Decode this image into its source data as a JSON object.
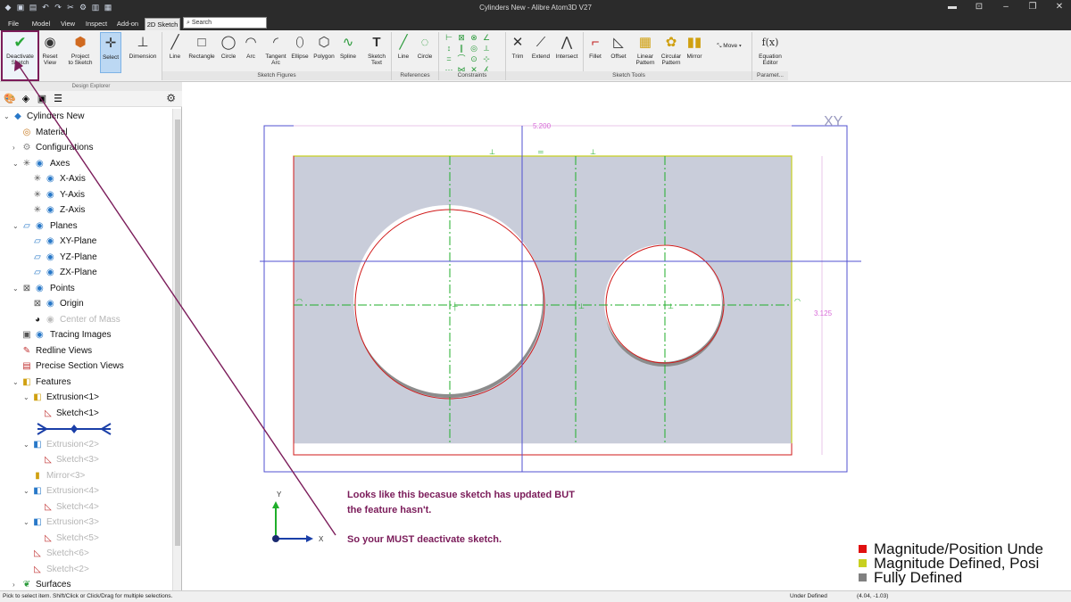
{
  "app": {
    "title": "Cylinders New - Alibre Atom3D V27"
  },
  "quick_access_icons": [
    "app-logo-icon",
    "save-icon",
    "open-icon",
    "undo-icon",
    "redo-icon",
    "cut-icon",
    "settings-icon",
    "folder-icon",
    "save-as-icon"
  ],
  "menu_tabs": [
    "File",
    "Model",
    "View",
    "Inspect",
    "Add-on",
    "2D Sketch"
  ],
  "active_tab": "2D Sketch",
  "search": {
    "placeholder": "Search"
  },
  "ribbon": {
    "buttons": [
      {
        "label_1": "Deactivate",
        "label_2": "Sketch"
      },
      {
        "label_1": "Reset",
        "label_2": "View"
      },
      {
        "label_1": "Project",
        "label_2": "to Sketch"
      },
      {
        "label_1": "Select",
        "label_2": ""
      },
      {
        "label_1": "Dimension",
        "label_2": ""
      },
      {
        "label_1": "Line",
        "label_2": ""
      },
      {
        "label_1": "Rectangle",
        "label_2": ""
      },
      {
        "label_1": "Circle",
        "label_2": ""
      },
      {
        "label_1": "Arc",
        "label_2": ""
      },
      {
        "label_1": "Tangent",
        "label_2": "Arc"
      },
      {
        "label_1": "Ellipse",
        "label_2": ""
      },
      {
        "label_1": "Polygon",
        "label_2": ""
      },
      {
        "label_1": "Spline",
        "label_2": ""
      },
      {
        "label_1": "Sketch",
        "label_2": "Text"
      },
      {
        "label_1": "Line",
        "label_2": ""
      },
      {
        "label_1": "Circle",
        "label_2": ""
      },
      {
        "label_1": "Trim",
        "label_2": ""
      },
      {
        "label_1": "Extend",
        "label_2": ""
      },
      {
        "label_1": "Intersect",
        "label_2": ""
      },
      {
        "label_1": "Fillet",
        "label_2": ""
      },
      {
        "label_1": "Offset",
        "label_2": ""
      },
      {
        "label_1": "Linear",
        "label_2": "Pattern"
      },
      {
        "label_1": "Circular",
        "label_2": "Pattern"
      },
      {
        "label_1": "Mirror",
        "label_2": ""
      },
      {
        "label_1": "Move",
        "label_2": ""
      },
      {
        "label_1": "Equation",
        "label_2": "Editor"
      }
    ],
    "groups": [
      "Sketch Figures",
      "References",
      "Constraints",
      "Sketch Tools",
      "Paramet..."
    ]
  },
  "explorer": {
    "header": "Design Explorer",
    "tree": [
      {
        "label": "Cylinders New",
        "icon": "part-icon"
      },
      {
        "label": "Material",
        "icon": "material-icon"
      },
      {
        "label": "Configurations",
        "icon": "configurations-icon"
      },
      {
        "label": "Axes",
        "icon": "axes-icon"
      },
      {
        "label": "X-Axis",
        "icon": "axis-icon"
      },
      {
        "label": "Y-Axis",
        "icon": "axis-icon"
      },
      {
        "label": "Z-Axis",
        "icon": "axis-icon"
      },
      {
        "label": "Planes",
        "icon": "planes-icon"
      },
      {
        "label": "XY-Plane",
        "icon": "plane-icon"
      },
      {
        "label": "YZ-Plane",
        "icon": "plane-icon"
      },
      {
        "label": "ZX-Plane",
        "icon": "plane-icon"
      },
      {
        "label": "Points",
        "icon": "points-icon"
      },
      {
        "label": "Origin",
        "icon": "origin-icon"
      },
      {
        "label": "Center of Mass",
        "icon": "center-of-mass-icon"
      },
      {
        "label": "Tracing Images",
        "icon": "image-icon"
      },
      {
        "label": "Redline Views",
        "icon": "redline-icon"
      },
      {
        "label": "Precise Section Views",
        "icon": "section-icon"
      },
      {
        "label": "Features",
        "icon": "features-icon"
      },
      {
        "label": "Extrusion<1>",
        "icon": "extrusion-icon"
      },
      {
        "label": "Sketch<1>",
        "icon": "sketch-icon"
      },
      {
        "label": "",
        "icon": "rollback-bar-icon"
      },
      {
        "label": "Extrusion<2>",
        "icon": "extrusion-icon"
      },
      {
        "label": "Sketch<3>",
        "icon": "sketch-icon"
      },
      {
        "label": "Mirror<3>",
        "icon": "mirror-icon"
      },
      {
        "label": "Extrusion<4>",
        "icon": "extrusion-icon"
      },
      {
        "label": "Sketch<4>",
        "icon": "sketch-icon"
      },
      {
        "label": "Extrusion<3>",
        "icon": "extrusion-icon"
      },
      {
        "label": "Sketch<5>",
        "icon": "sketch-icon"
      },
      {
        "label": "Sketch<6>",
        "icon": "sketch-icon"
      },
      {
        "label": "Sketch<2>",
        "icon": "sketch-icon"
      },
      {
        "label": "Surfaces",
        "icon": "surfaces-icon"
      }
    ]
  },
  "canvas": {
    "plane_label": "XY",
    "dim_width": "5.200",
    "dim_height": "3.125",
    "axis_y": "Y",
    "axis_x": "X",
    "annotation_line1": "Looks like this becasue sketch has updated BUT",
    "annotation_line2": "the feature hasn't.",
    "annotation_line3": "So your MUST deactivate sketch.",
    "legend": [
      {
        "label": "Magnitude/Position Unde",
        "color": "#e01010"
      },
      {
        "label": "Magnitude Defined, Posi",
        "color": "#c8d020"
      },
      {
        "label": "Fully Defined",
        "color": "#808080"
      }
    ],
    "colors": {
      "face_fill": "#c9cdda",
      "sketch_red": "#d01818",
      "sketch_yellow": "#c8d020",
      "construction_green": "#1fae2a",
      "plane_blue": "#5050d0",
      "dimension_magenta": "#d86ad8",
      "annotation_purple": "#7b1c5a"
    }
  },
  "status": {
    "hint": "Pick to select item. Shift/Click or Click/Drag for multiple selections.",
    "state": "Under Defined",
    "coords": "(4.04, -1.03)"
  }
}
